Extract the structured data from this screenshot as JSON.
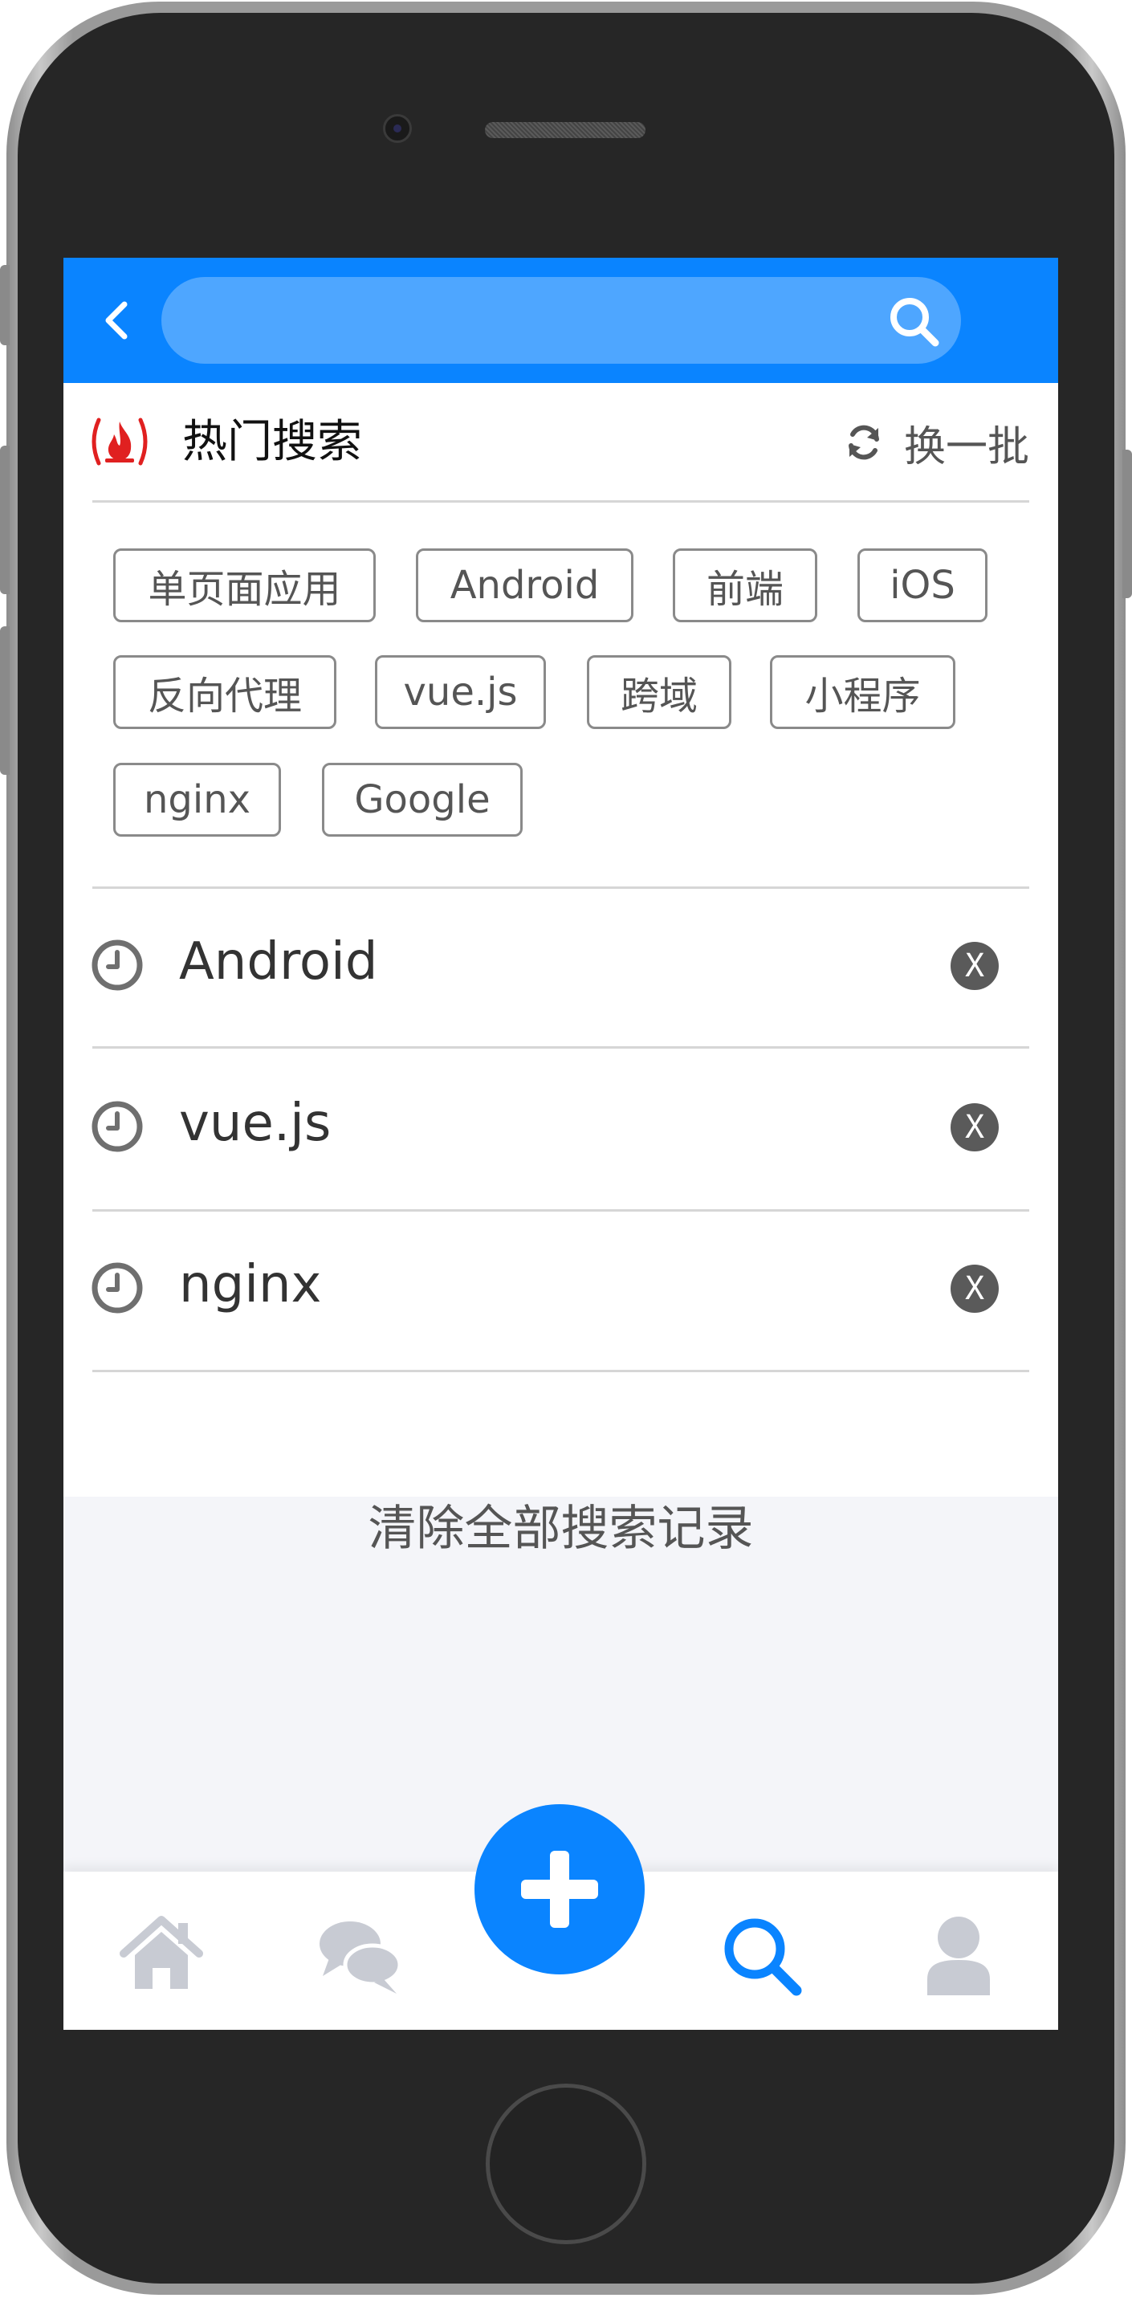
{
  "header": {
    "search_placeholder": ""
  },
  "hot": {
    "title": "热门搜索",
    "refresh_label": "换一批",
    "tags": [
      "单页面应用",
      "Android",
      "前端",
      "iOS",
      "反向代理",
      "vue.js",
      "跨域",
      "小程序",
      "nginx",
      "Google"
    ]
  },
  "history": {
    "items": [
      "Android",
      "vue.js",
      "nginx"
    ],
    "delete_label": "X",
    "clear_all": "清除全部搜索记录"
  },
  "tabbar": {
    "items": [
      "home-icon",
      "chat-icon",
      "add-icon",
      "search-icon",
      "user-icon"
    ],
    "active": "search-icon"
  },
  "colors": {
    "accent": "#0a84ff",
    "search_field": "#4ea6ff",
    "fire": "#e02020",
    "tab_inactive": "#c8cbd3"
  }
}
